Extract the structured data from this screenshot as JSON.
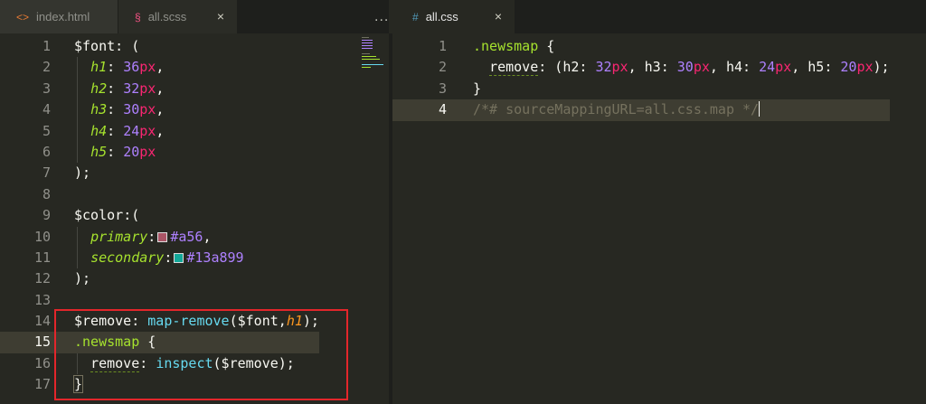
{
  "left_tabs": [
    {
      "label": "index.html",
      "icon": "<>"
    },
    {
      "label": "all.scss",
      "icon": "§"
    }
  ],
  "right_tabs": [
    {
      "label": "all.css",
      "icon": "#"
    }
  ],
  "more_label": "...",
  "close_glyph": "×",
  "left_code": {
    "line_numbers": [
      "1",
      "2",
      "3",
      "4",
      "5",
      "6",
      "7",
      "8",
      "9",
      "10",
      "11",
      "12",
      "13",
      "14",
      "15",
      "16",
      "17"
    ],
    "l1_a": "$font",
    "l1_b": ": (",
    "l2_k": "h1",
    "l2_n": "36",
    "l2_u": "px",
    "l2_p": ",",
    "l3_k": "h2",
    "l3_n": "32",
    "l3_u": "px",
    "l3_p": ",",
    "l4_k": "h3",
    "l4_n": "30",
    "l4_u": "px",
    "l4_p": ",",
    "l5_k": "h4",
    "l5_n": "24",
    "l5_u": "px",
    "l5_p": ",",
    "l6_k": "h5",
    "l6_n": "20",
    "l6_u": "px",
    "l7": ");",
    "l9_a": "$color",
    "l9_b": ":(",
    "l10_k": "primary",
    "l10_c": ":",
    "l10_v": "#a56",
    "l10_p": ",",
    "l11_k": "secondary",
    "l11_c": ":",
    "l11_v": "#13a899",
    "l12": ");",
    "l14_a": "$remove",
    "l14_b": ": ",
    "l14_fn": "map-remove",
    "l14_c": "($font,",
    "l14_k": "h1",
    "l14_d": ");",
    "l15_sel": ".newsmap",
    "l15_b": " {",
    "l16_p": "remove",
    "l16_c": ": ",
    "l16_fn": "inspect",
    "l16_d": "($remove);",
    "l17": "}"
  },
  "right_code": {
    "line_numbers": [
      "1",
      "2",
      "3",
      "4"
    ],
    "r1_sel": ".newsmap",
    "r1_b": " {",
    "r2_p": "remove",
    "r2_a": ": (h2",
    "r2_b": ": ",
    "r2_n1": "32",
    "r2_u1": "px",
    "r2_c": ", h3: ",
    "r2_n2": "30",
    "r2_u2": "px",
    "r2_d": ", h4: ",
    "r2_n3": "24",
    "r2_u3": "px",
    "r2_e": ", h5: ",
    "r2_n4": "20",
    "r2_u4": "px",
    "r2_f": ");",
    "r3": "}",
    "r4": "/*# sourceMappingURL=all.css.map */"
  },
  "swatch_colors": {
    "primary": "#aa5566",
    "secondary": "#13a899"
  }
}
